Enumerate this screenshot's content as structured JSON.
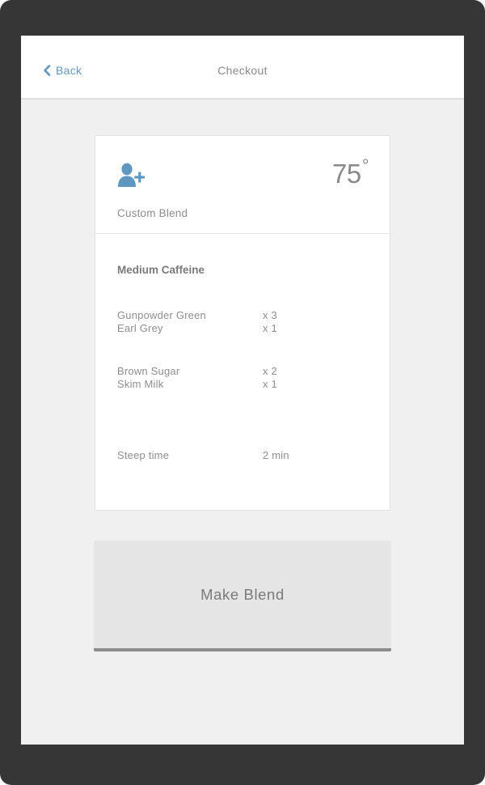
{
  "colors": {
    "frame": "#363637",
    "screen_bg": "#f0f0f0",
    "accent": "#5f97bf",
    "text": "#8e8e8e",
    "button_bg": "#e5e5e5",
    "button_border": "#8c8c8c"
  },
  "header": {
    "back_label": "Back",
    "back_icon": "chevron-left-icon",
    "title": "Checkout"
  },
  "blend": {
    "icon": "add-user-icon",
    "temperature": "75",
    "temperature_unit": "°",
    "name": "Custom Blend",
    "caffeine": "Medium Caffeine",
    "teas": [
      {
        "name": "Gunpowder Green",
        "qty": "x 3"
      },
      {
        "name": "Earl Grey",
        "qty": "x 1"
      }
    ],
    "additions": [
      {
        "name": "Brown Sugar",
        "qty": "x 2"
      },
      {
        "name": "Skim Milk",
        "qty": "x 1"
      }
    ],
    "steep": {
      "label": "Steep time",
      "value": "2 min"
    }
  },
  "actions": {
    "make_label": "Make Blend"
  }
}
